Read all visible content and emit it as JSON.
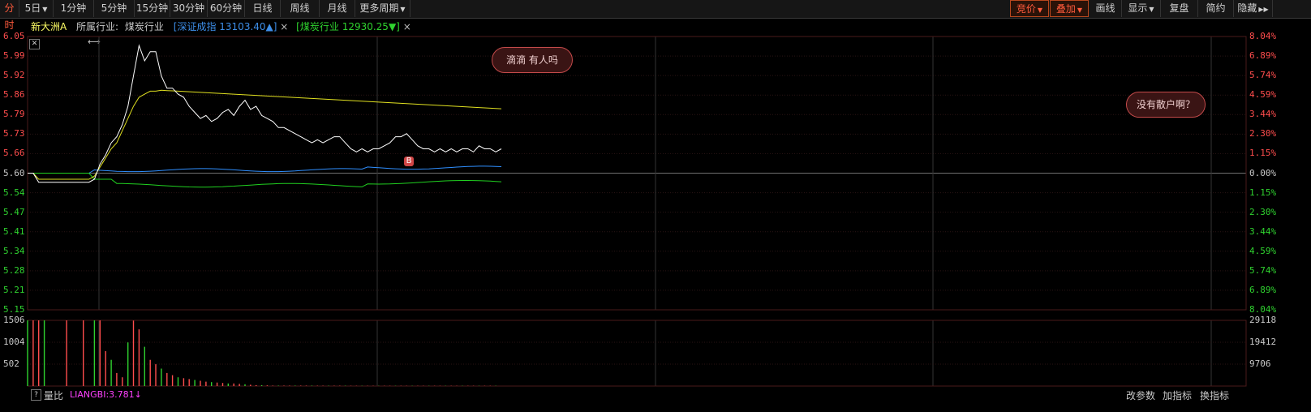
{
  "toolbar": {
    "left_items": [
      "分时",
      "5日",
      "1分钟",
      "5分钟",
      "15分钟",
      "30分钟",
      "60分钟",
      "日线",
      "周线",
      "月线",
      "更多周期"
    ],
    "right_items": [
      "竞价",
      "叠加",
      "画线",
      "显示",
      "复盘",
      "简约",
      "隐藏"
    ]
  },
  "infobar": {
    "stock_name": "新大洲A",
    "industry_label": "所属行业:",
    "industry_name": "煤炭行业",
    "index1_name": "[深证成指",
    "index1_value": "13103.40▲]",
    "index2_name": "[煤炭行业",
    "index2_value": "12930.25▼]",
    "close_mark": "×"
  },
  "price_axis": {
    "left_labels": [
      "6.05",
      "5.99",
      "5.92",
      "5.86",
      "5.79",
      "5.73",
      "5.66",
      "5.60",
      "5.54",
      "5.47",
      "5.41",
      "5.34",
      "5.28",
      "5.21",
      "5.15"
    ],
    "right_labels": [
      "8.04%",
      "6.89%",
      "5.74%",
      "4.59%",
      "3.44%",
      "2.30%",
      "1.15%",
      "0.00%",
      "1.15%",
      "2.30%",
      "3.44%",
      "4.59%",
      "5.74%",
      "6.89%",
      "8.04%"
    ],
    "base_price": 5.6
  },
  "volume_axis": {
    "left_labels": [
      "1506",
      "1004",
      "502"
    ],
    "right_labels": [
      "29118",
      "19412",
      "9706"
    ]
  },
  "bubbles": [
    "滴滴   有人吗",
    "没有散户啊？"
  ],
  "marker_b": "B",
  "bottom": {
    "help": "?",
    "ratio_label": "量比",
    "indicator": "LIANGBI:3.781↓",
    "buttons": [
      "改参数",
      "加指标",
      "换指标"
    ]
  },
  "colors": {
    "price_up": "#ff4d4d",
    "price_down": "#2fd22f",
    "price_line": "#ffffff",
    "avg_line": "#e0e020",
    "index1_line": "#2f8fff",
    "index2_line": "#20d020",
    "grid": "#3a1a1a"
  },
  "chart_data": {
    "type": "line",
    "series": [
      {
        "name": "price",
        "values": [
          5.6,
          5.6,
          5.57,
          5.57,
          5.57,
          5.57,
          5.57,
          5.57,
          5.57,
          5.57,
          5.57,
          5.57,
          5.58,
          5.63,
          5.66,
          5.7,
          5.72,
          5.76,
          5.82,
          5.92,
          6.02,
          5.97,
          6.0,
          6.0,
          5.92,
          5.88,
          5.88,
          5.86,
          5.85,
          5.82,
          5.8,
          5.78,
          5.79,
          5.77,
          5.78,
          5.8,
          5.81,
          5.79,
          5.82,
          5.84,
          5.81,
          5.82,
          5.79,
          5.78,
          5.77,
          5.75,
          5.75,
          5.74,
          5.73,
          5.72,
          5.71,
          5.7,
          5.71,
          5.7,
          5.71,
          5.72,
          5.72,
          5.7,
          5.68,
          5.67,
          5.68,
          5.67,
          5.68,
          5.68,
          5.69,
          5.7,
          5.72,
          5.72,
          5.73,
          5.71,
          5.69,
          5.68,
          5.68,
          5.67,
          5.68,
          5.67,
          5.68,
          5.67,
          5.68,
          5.68,
          5.67,
          5.69,
          5.68,
          5.68,
          5.67,
          5.68
        ]
      },
      {
        "name": "avg",
        "values": [
          5.6,
          5.6,
          5.58,
          5.58,
          5.58,
          5.58,
          5.58,
          5.58,
          5.58,
          5.58,
          5.58,
          5.58,
          5.59,
          5.62,
          5.65,
          5.68,
          5.7,
          5.74,
          5.78,
          5.82,
          5.85,
          5.86,
          5.87,
          5.87,
          5.873,
          5.872,
          5.871,
          5.87,
          5.869,
          5.868,
          5.867,
          5.866,
          5.865,
          5.864,
          5.863,
          5.862,
          5.861,
          5.86,
          5.859,
          5.858,
          5.857,
          5.856,
          5.855,
          5.854,
          5.853,
          5.852,
          5.851,
          5.85,
          5.849,
          5.848,
          5.847,
          5.846,
          5.845,
          5.844,
          5.843,
          5.842,
          5.841,
          5.84,
          5.839,
          5.838,
          5.837,
          5.836,
          5.835,
          5.834,
          5.833,
          5.832,
          5.831,
          5.83,
          5.829,
          5.828,
          5.827,
          5.826,
          5.825,
          5.824,
          5.823,
          5.822,
          5.821,
          5.82,
          5.819,
          5.818,
          5.817,
          5.816,
          5.815,
          5.814,
          5.813,
          5.812
        ]
      }
    ],
    "volume": [
      1506,
      1506,
      1506,
      1506,
      0,
      0,
      0,
      1506,
      0,
      0,
      1506,
      0,
      1506,
      1506,
      800,
      600,
      300,
      200,
      1000,
      1500,
      1300,
      900,
      600,
      500,
      400,
      300,
      250,
      200,
      180,
      160,
      140,
      120,
      100,
      90,
      80,
      70,
      60,
      60,
      50,
      40,
      30,
      20,
      20,
      15,
      10,
      10,
      10,
      10,
      10,
      10,
      10,
      10,
      8,
      8,
      8,
      8,
      8,
      8,
      6,
      6,
      6,
      6,
      6,
      6,
      6,
      6,
      6,
      6,
      6,
      6,
      6,
      6,
      6,
      6,
      6,
      6,
      6,
      6,
      6,
      6,
      6,
      6,
      6,
      6,
      6
    ]
  }
}
